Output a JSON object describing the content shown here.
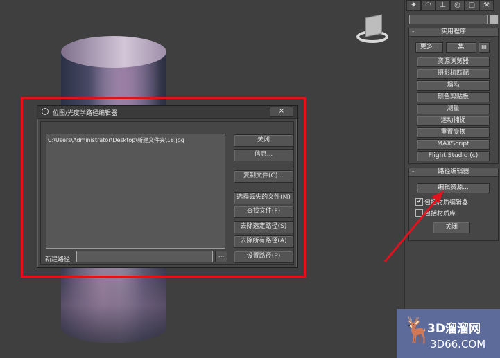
{
  "dialog": {
    "title": "位图/光度学路径编辑器",
    "close_x": "×",
    "file_entry": "C:\\Users\\Administrator\\Desktop\\新建文件夹\\18.jpg",
    "buttons": {
      "close": "关闭",
      "info": "信息...",
      "copy_files": "复制文件(C)...",
      "select_missing": "选择丢失的文件(M)",
      "find_files": "查找文件(F)",
      "strip_selected": "去除选定路径(S)",
      "strip_all": "去除所有路径(A)",
      "set_path": "设置路径(P)"
    },
    "new_path_label": "新建路径:",
    "new_path_value": "",
    "browse": "..."
  },
  "command_panel": {
    "tabs": [
      "create-icon",
      "modify-icon",
      "hierarchy-icon",
      "motion-icon",
      "display-icon",
      "utilities-icon"
    ],
    "utilities": {
      "header": "实用程序",
      "more": "更多...",
      "sets": "集",
      "items": [
        "资源浏览器",
        "摄影机匹配",
        "塌陷",
        "颜色剪贴板",
        "测量",
        "运动捕捉",
        "重置变换",
        "MAXScript",
        "Flight Studio (c)"
      ]
    },
    "path_editor": {
      "header": "路径编辑器",
      "edit_resources": "编辑资源...",
      "include_mtl_editor": "包括材质编辑器",
      "include_mtl_editor_checked": true,
      "include_mtl_library": "包括材质库",
      "include_mtl_library_checked": false,
      "close": "关闭"
    }
  },
  "watermark": {
    "line1": "3D溜溜网",
    "line2": "3D66.COM"
  },
  "colors": {
    "highlight": "#e0121d",
    "watermark_bg": "#5c6b9a"
  }
}
